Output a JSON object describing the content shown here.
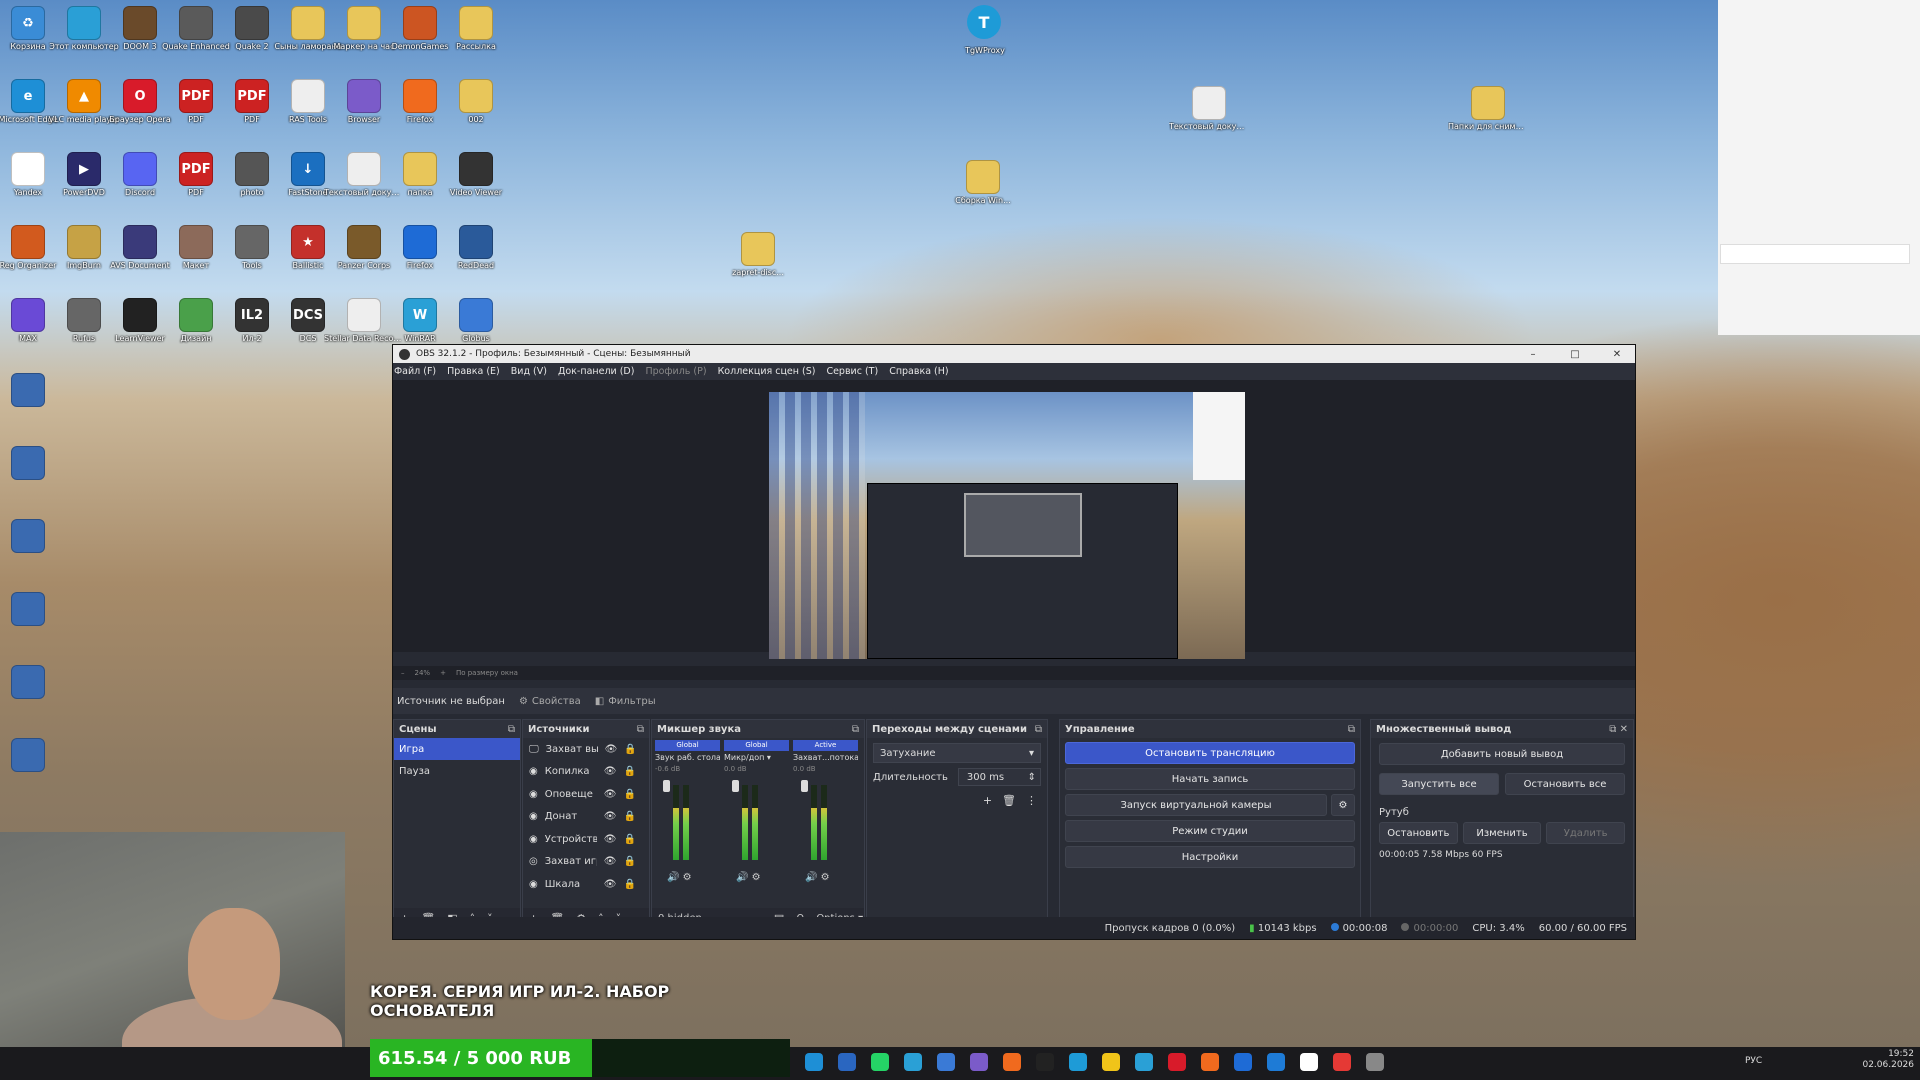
{
  "desktop": {
    "icons": [
      {
        "label": "Корзина",
        "color": "#3a8cd6",
        "glyph": "♻"
      },
      {
        "label": "Этот компьютер",
        "color": "#2a9fd6",
        "glyph": ""
      },
      {
        "label": "DOOM 3",
        "color": "#6a4a2a",
        "glyph": ""
      },
      {
        "label": "Quake Enhanced",
        "color": "#5a5a5a",
        "glyph": ""
      },
      {
        "label": "Quake 2",
        "color": "#4a4a4a",
        "glyph": ""
      },
      {
        "label": "Сыны ламорана",
        "color": "#e8c65a",
        "glyph": ""
      },
      {
        "label": "Маркер на час",
        "color": "#e8c65a",
        "glyph": ""
      },
      {
        "label": "DemonGames",
        "color": "#cc5522",
        "glyph": ""
      },
      {
        "label": "Рассылка",
        "color": "#e8c65a",
        "glyph": ""
      },
      {
        "label": "Microsoft Edge",
        "color": "#1e8fd6",
        "glyph": "e"
      },
      {
        "label": "VLC media player",
        "color": "#f08a00",
        "glyph": "▲"
      },
      {
        "label": "Браузер Opera",
        "color": "#d81b2a",
        "glyph": "O"
      },
      {
        "label": "PDF",
        "color": "#cc2222",
        "glyph": "PDF"
      },
      {
        "label": "PDF",
        "color": "#cc2222",
        "glyph": "PDF"
      },
      {
        "label": "RAS Tools",
        "color": "#eeeeee",
        "glyph": ""
      },
      {
        "label": "Browser",
        "color": "#7b5bc9",
        "glyph": ""
      },
      {
        "label": "Firefox",
        "color": "#f06a1e",
        "glyph": ""
      },
      {
        "label": "002",
        "color": "#e8c65a",
        "glyph": ""
      },
      {
        "label": "Yandex",
        "color": "#ffffff",
        "glyph": "Y"
      },
      {
        "label": "PowerDVD",
        "color": "#2a2a6a",
        "glyph": "▶"
      },
      {
        "label": "Discord",
        "color": "#5865f2",
        "glyph": ""
      },
      {
        "label": "PDF",
        "color": "#cc2222",
        "glyph": "PDF"
      },
      {
        "label": "photo",
        "color": "#555555",
        "glyph": ""
      },
      {
        "label": "FastStone",
        "color": "#1b6fc0",
        "glyph": "↓"
      },
      {
        "label": "Текстовый документ",
        "color": "#eeeeee",
        "glyph": ""
      },
      {
        "label": "папка",
        "color": "#e8c65a",
        "glyph": ""
      },
      {
        "label": "Video Viewer",
        "color": "#333333",
        "glyph": ""
      },
      {
        "label": "Reg Organizer",
        "color": "#d25a1e",
        "glyph": ""
      },
      {
        "label": "ImgBurn",
        "color": "#c6a245",
        "glyph": ""
      },
      {
        "label": "AVS Document",
        "color": "#3a3a7a",
        "glyph": ""
      },
      {
        "label": "Макет",
        "color": "#8c6a5a",
        "glyph": ""
      },
      {
        "label": "Tools",
        "color": "#666666",
        "glyph": ""
      },
      {
        "label": "Ballistic",
        "color": "#c4302b",
        "glyph": "★"
      },
      {
        "label": "Panzer Corps",
        "color": "#7a5a2a",
        "glyph": ""
      },
      {
        "label": "Firefox",
        "color": "#1e6bd6",
        "glyph": ""
      },
      {
        "label": "RedDead",
        "color": "#2a5a9a",
        "glyph": ""
      },
      {
        "label": "MAX",
        "color": "#6a4ad6",
        "glyph": ""
      },
      {
        "label": "Rufus",
        "color": "#666666",
        "glyph": ""
      },
      {
        "label": "LearnViewer",
        "color": "#222222",
        "glyph": ""
      },
      {
        "label": "Дизайн",
        "color": "#4aa04a",
        "glyph": ""
      },
      {
        "label": "Ил-2",
        "color": "#333333",
        "glyph": "IL2"
      },
      {
        "label": "DCS",
        "color": "#333333",
        "glyph": "DCS"
      },
      {
        "label": "Stellar Data Recovery",
        "color": "#eeeeee",
        "glyph": ""
      },
      {
        "label": "WinRAR",
        "color": "#2aa0d6",
        "glyph": "W"
      },
      {
        "label": "Globus",
        "color": "#3a7ad6",
        "glyph": ""
      }
    ],
    "right_icons": [
      {
        "label": "TgWProxy",
        "color": "#1e9bd7"
      },
      {
        "label": "Текстовый докумен...",
        "color": "#eeeeee"
      },
      {
        "label": "Папки для снимков",
        "color": "#e8c65a"
      },
      {
        "label": "Сборка Win...",
        "color": "#e8c65a"
      },
      {
        "label": "zapret-disc...",
        "color": "#e8c65a"
      }
    ],
    "avatar_letter": "T"
  },
  "obs": {
    "window_title": "OBS 32.1.2 - Профиль: Безымянный - Сцены: Безымянный",
    "menu": [
      "Файл (F)",
      "Правка (E)",
      "Вид (V)",
      "Док-панели (D)",
      "Профиль (P)",
      "Коллекция сцен (S)",
      "Сервис (T)",
      "Справка (H)"
    ],
    "zoom": "24%",
    "zoom_fit": "По размеру окна",
    "source_status": "Источник не выбран",
    "properties": "Свойства",
    "filters": "Фильтры",
    "scenes": {
      "title": "Сцены",
      "items": [
        "Игра",
        "Пауза"
      ]
    },
    "sources": {
      "title": "Источники",
      "items": [
        "Захват вы",
        "Копилка",
        "Оповеще",
        "Донат",
        "Устройств",
        "Захват игр",
        "Шкала"
      ]
    },
    "mixer": {
      "title": "Микшер звука",
      "channels": [
        {
          "badge": "Global",
          "name": "Звук раб. стола",
          "db": "-0.6 dB"
        },
        {
          "badge": "Global",
          "name": "Микр/доп",
          "db": "0.0 dB"
        },
        {
          "badge": "Active",
          "name": "Захват...потока",
          "db": "0.0 dB"
        }
      ],
      "hidden": "0 hidden",
      "options": "Options"
    },
    "transitions": {
      "title": "Переходы между сценами",
      "type": "Затухание",
      "duration_label": "Длительность",
      "duration": "300 ms"
    },
    "controls": {
      "title": "Управление",
      "stop_stream": "Остановить трансляцию",
      "start_record": "Начать запись",
      "virtual_cam": "Запуск виртуальной камеры",
      "studio_mode": "Режим студии",
      "settings": "Настройки"
    },
    "multi": {
      "title": "Множественный вывод",
      "add": "Добавить новый вывод",
      "start_all": "Запустить все",
      "stop_all": "Остановить все",
      "target": "Рутуб",
      "stop": "Остановить",
      "edit": "Изменить",
      "delete": "Удалить",
      "stats": "00:00:05  7.58 Mbps  60 FPS"
    },
    "status": {
      "dropped": "Пропуск кадров 0 (0.0%)",
      "bitrate": "10143 kbps",
      "stream_time": "00:00:08",
      "rec_time": "00:00:00",
      "cpu": "CPU: 3.4%",
      "fps": "60.00 / 60.00 FPS"
    }
  },
  "overlay": {
    "title_line1": "КОРЕЯ. СЕРИЯ ИГР ИЛ-2. НАБОР",
    "title_line2": "ОСНОВАТЕЛЯ",
    "donation": "615.54 / 5 000 RUB"
  },
  "taskbar": {
    "lang": "РУС",
    "time": "19:52",
    "date": "02.06.2026"
  }
}
